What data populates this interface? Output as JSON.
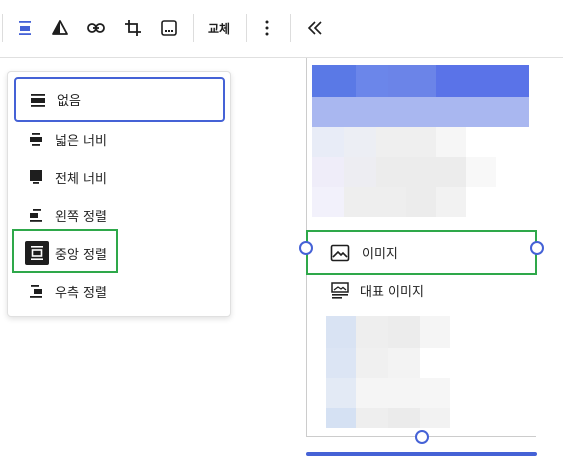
{
  "toolbar": {
    "items": [
      {
        "name": "align-icon",
        "active": true
      },
      {
        "name": "warning-triangle-icon"
      },
      {
        "name": "link-icon"
      },
      {
        "name": "crop-icon"
      },
      {
        "name": "text-overlay-icon"
      }
    ],
    "replace_label": "교체",
    "more_icon": "vertical-ellipsis-icon",
    "collapse_icon": "double-chevron-left-icon"
  },
  "align_menu": {
    "items": [
      {
        "label": "없음",
        "icon": "align-none-icon",
        "focused": true
      },
      {
        "label": "넓은 너비",
        "icon": "align-wide-icon"
      },
      {
        "label": "전체 너비",
        "icon": "align-full-icon"
      },
      {
        "label": "왼쪽 정렬",
        "icon": "align-left-icon"
      },
      {
        "label": "중앙 정렬",
        "icon": "align-center-icon",
        "selected": true
      },
      {
        "label": "우측 정렬",
        "icon": "align-right-icon"
      }
    ]
  },
  "canvas": {
    "image_block_label": "이미지",
    "featured_image_label": "대표 이미지"
  },
  "colors": {
    "accent": "#4562d6",
    "highlight": "#2ea84a"
  }
}
